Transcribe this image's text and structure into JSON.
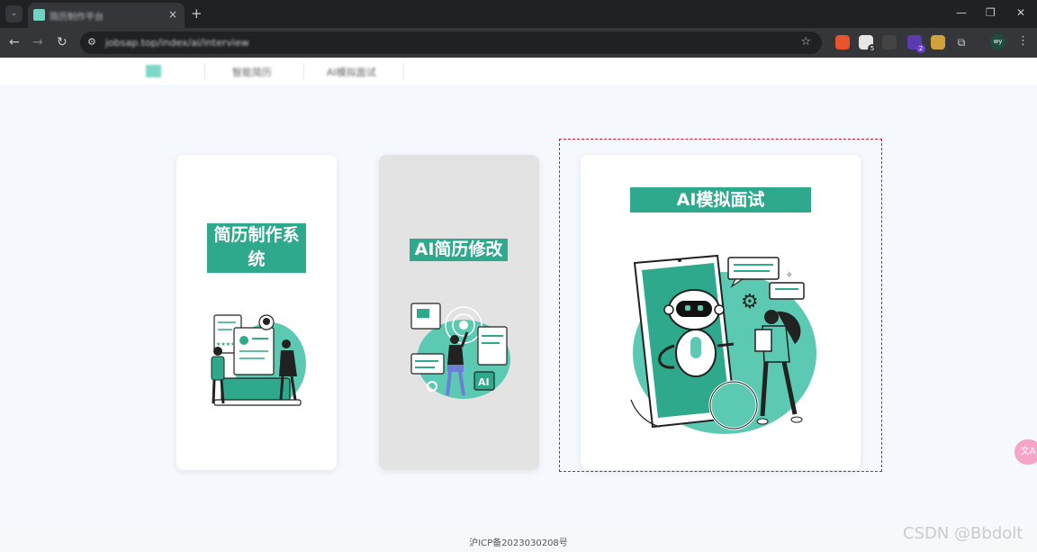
{
  "browser": {
    "tab_title": "简历制作平台",
    "url": "jobsap.top/index/ai/interview",
    "tab_close": "×",
    "new_tab": "+",
    "menu_icon": "⋮",
    "minimize": "—",
    "restore": "❐",
    "close": "✕",
    "profile_initials": "wy",
    "extensions": [
      {
        "name": "ext-red",
        "color": "#e8542b",
        "badge": ""
      },
      {
        "name": "ext-qr",
        "color": "#e6e6e6",
        "badge": "5"
      },
      {
        "name": "ext-panda",
        "color": "#444",
        "badge": ""
      },
      {
        "name": "ext-purple",
        "color": "#5b3bb0",
        "badge": "2"
      },
      {
        "name": "ext-bird",
        "color": "#d0a23c",
        "badge": ""
      }
    ]
  },
  "sitenav": {
    "links": [
      "智能简历",
      "AI模拟面试"
    ]
  },
  "cards": [
    {
      "title": "简历制作系统"
    },
    {
      "title": "AI简历修改",
      "ai_tag": "AI"
    },
    {
      "title": "AI模拟面试"
    }
  ],
  "footer": {
    "icp": "沪ICP备2023030208号"
  },
  "watermark": "CSDN @Bbdolt",
  "colors": {
    "accent": "#2ea98b",
    "accent_light": "#5ccab3",
    "selection": "#d9142b"
  }
}
